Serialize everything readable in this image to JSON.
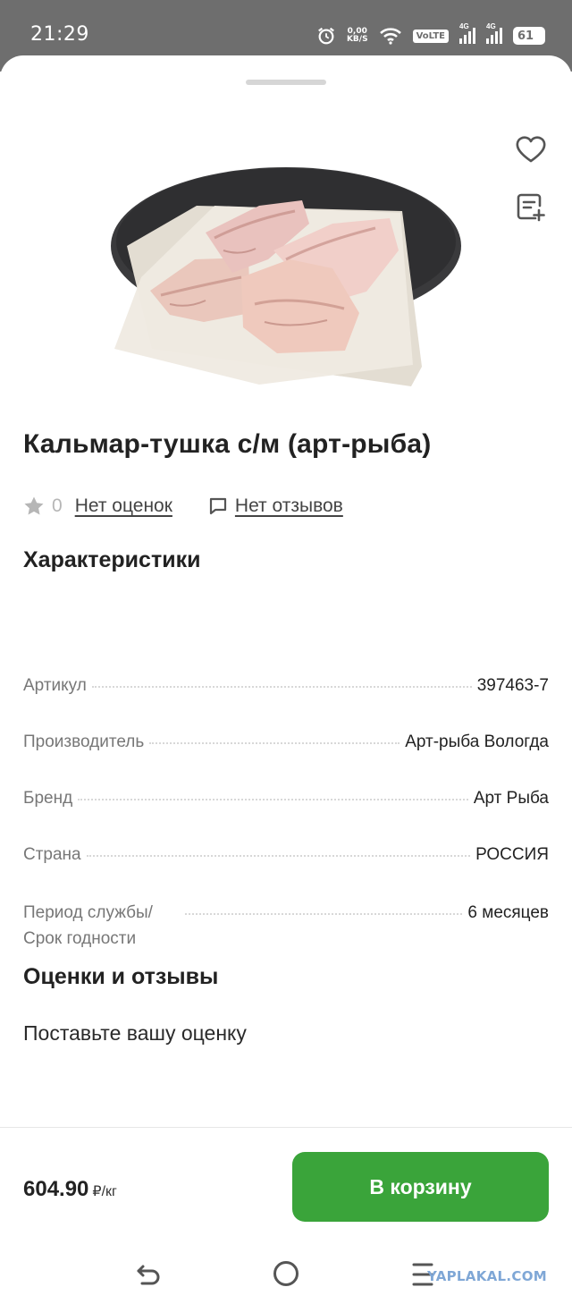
{
  "status_bar": {
    "time": "21:29",
    "speed_value": "0,00",
    "speed_unit": "KB/S",
    "volte": "VoLTE",
    "sim1_label": "4G",
    "sim2_label": "4G",
    "battery": "61"
  },
  "product": {
    "title": "Кальмар-тушка с/м (арт-рыба)",
    "rating_value": "0",
    "ratings_link": "Нет оценок",
    "reviews_link": "Нет отзывов"
  },
  "specs": {
    "title": "Характеристики",
    "rows": [
      {
        "label": "Артикул",
        "value": "397463-7"
      },
      {
        "label": "Производитель",
        "value": "Арт-рыба Вологда"
      },
      {
        "label": "Бренд",
        "value": "Арт Рыба"
      },
      {
        "label": "Страна",
        "value": "РОССИЯ"
      },
      {
        "label": "Период службы/ Срок годности",
        "value": "6 месяцев"
      }
    ]
  },
  "reviews": {
    "title": "Оценки и отзывы",
    "prompt": "Поставьте вашу оценку"
  },
  "purchase": {
    "price": "604.90",
    "unit": "₽/кг",
    "cart_button": "В корзину"
  },
  "watermark": "YAPLAKAL.COM",
  "colors": {
    "accent_green": "#3aa43a",
    "status_bar": "#6e6e6e"
  }
}
